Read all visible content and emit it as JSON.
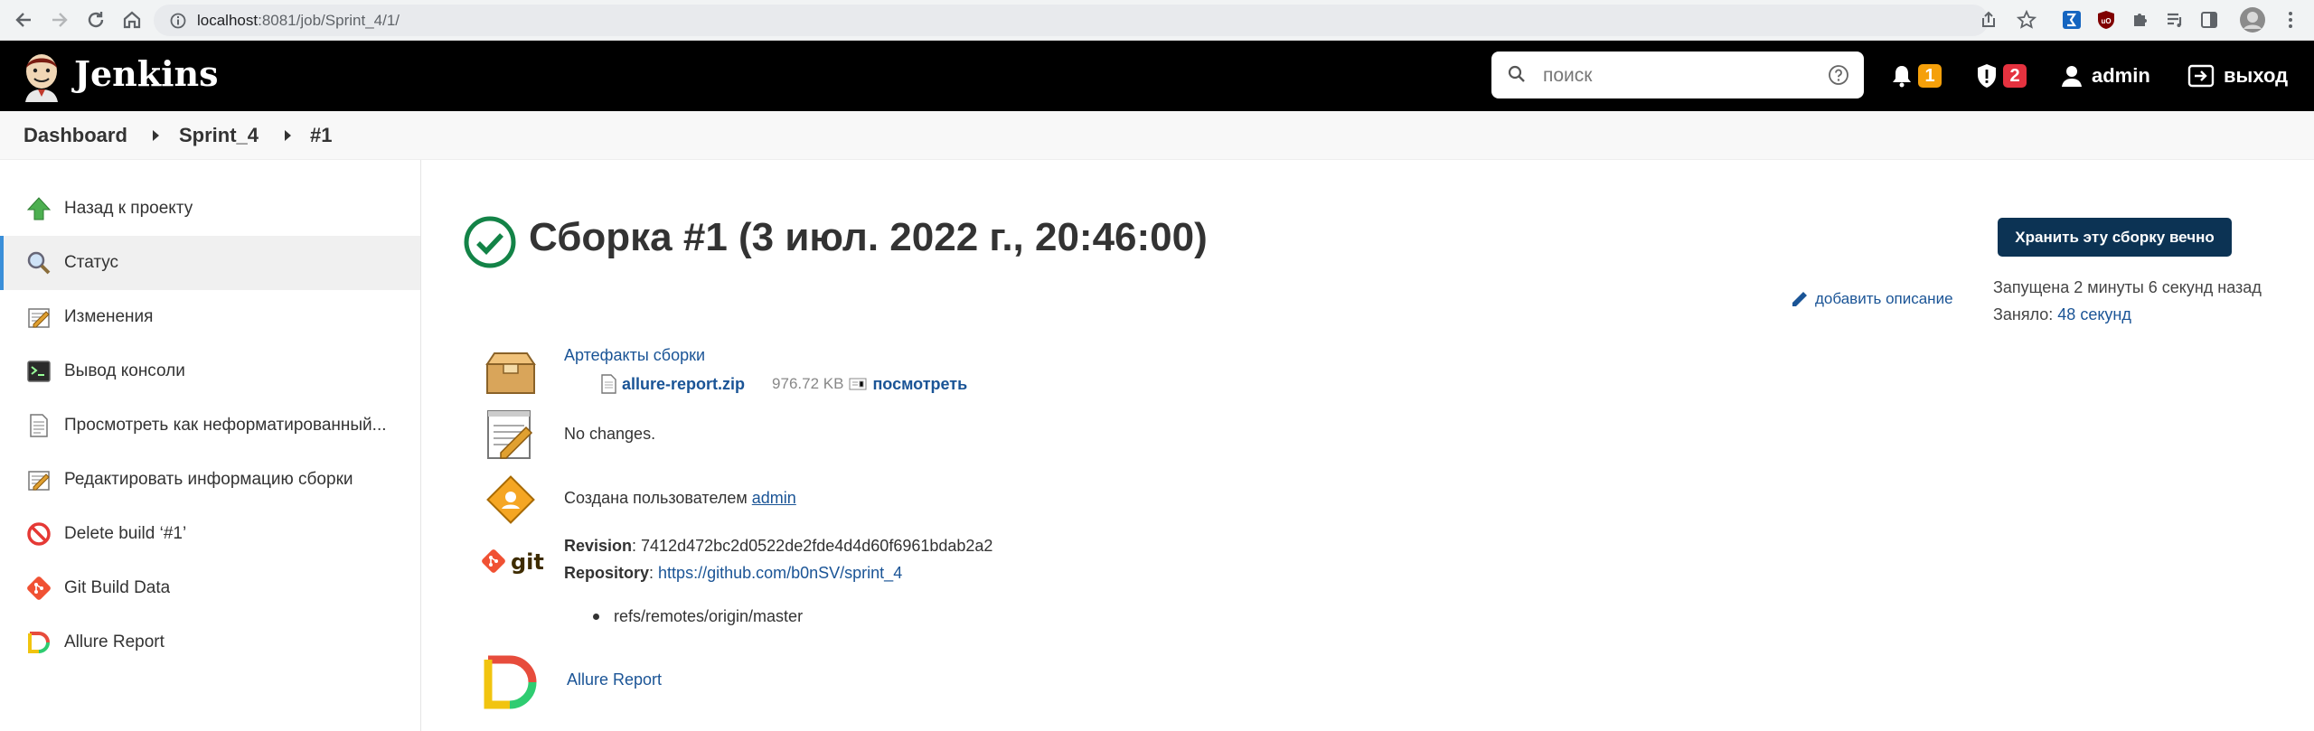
{
  "browser": {
    "url_host": "localhost",
    "url_rest": ":8081/job/Sprint_4/1/"
  },
  "header": {
    "brand": "Jenkins",
    "search_placeholder": "поиск",
    "notifications_count": "1",
    "security_count": "2",
    "user": "admin",
    "logout": "выход",
    "colors": {
      "notif_badge": "#f5a00a",
      "security_badge": "#e5323f"
    }
  },
  "breadcrumb": [
    "Dashboard",
    "Sprint_4",
    "#1"
  ],
  "sidebar": {
    "items": [
      {
        "label": "Назад к проекту",
        "icon": "up-arrow-icon"
      },
      {
        "label": "Статус",
        "icon": "magnifier-icon"
      },
      {
        "label": "Изменения",
        "icon": "notepad-icon"
      },
      {
        "label": "Вывод консоли",
        "icon": "terminal-icon"
      },
      {
        "label": "Просмотреть как неформатированный...",
        "icon": "document-icon"
      },
      {
        "label": "Редактировать информацию сборки",
        "icon": "notepad-edit-icon"
      },
      {
        "label": "Delete build ‘#1’",
        "icon": "no-entry-icon"
      },
      {
        "label": "Git Build Data",
        "icon": "git-icon"
      },
      {
        "label": "Allure Report",
        "icon": "allure-icon"
      }
    ],
    "active_index": 1
  },
  "main": {
    "title": "Сборка #1 (3 июл. 2022 г., 20:46:00)",
    "keep_button": "Хранить эту сборку вечно",
    "add_description": "добавить описание",
    "started": "Запущена 2 минуты 6 секунд назад",
    "took_label": "Заняло: ",
    "took_value": "48 секунд",
    "artifacts_title": "Артефакты сборки",
    "artifact_file": "allure-report.zip",
    "artifact_size": "976.72 KB",
    "artifact_view": "посмотреть",
    "no_changes": "No changes.",
    "created_by_label": "Создана пользователем ",
    "created_by_user": "admin",
    "revision_label": "Revision",
    "revision_value": ": 7412d472bc2d0522de2fde4d4d60f6961bdab2a2",
    "repository_label": "Repository",
    "repository_sep": ": ",
    "repository_url": "https://github.com/b0nSV/sprint_4",
    "branch": "refs/remotes/origin/master",
    "git_logo_text": "git",
    "allure_link": "Allure Report"
  }
}
